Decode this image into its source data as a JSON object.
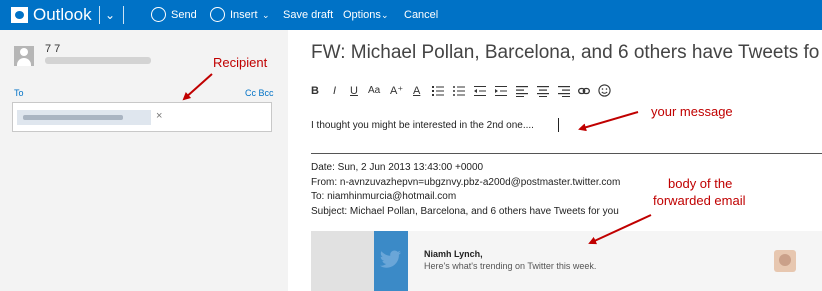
{
  "topbar": {
    "app_title": "Outlook",
    "send_label": "Send",
    "insert_label": "Insert",
    "save_draft_label": "Save draft",
    "options_label": "Options",
    "cancel_label": "Cancel",
    "caret": "⌄",
    "bg_color": "#0072c6"
  },
  "sender": {
    "name": "7 7"
  },
  "recipients": {
    "to_label": "To",
    "ccbcc_label": "Cc Bcc",
    "remove_glyph": "×"
  },
  "subject": "FW: Michael Pollan, Barcelona, and 6 others have Tweets fo",
  "toolbar": {
    "bold": "B",
    "italic": "I",
    "underline": "U",
    "font_size": "Aa",
    "grow": "A⁺",
    "font_color": "A"
  },
  "body": {
    "text": "I thought you might be interested in the 2nd one...."
  },
  "forwarded_headers": {
    "date": "Date: Sun, 2 Jun 2013 13:43:00 +0000",
    "from": "From: n-avnzuvazhepvn=ubgznvy.pbz-a200d@postmaster.twitter.com",
    "to": "To: niamhinmurcia@hotmail.com",
    "subject": "Subject: Michael Pollan, Barcelona, and 6 others have Tweets for you"
  },
  "forwarded_content": {
    "name": "Niamh Lynch,",
    "subtitle": "Here's what's trending on Twitter this week."
  },
  "annotations": {
    "recipient": "Recipient",
    "your_message": "your message",
    "body_line1": "body of the",
    "body_line2": "forwarded email"
  }
}
